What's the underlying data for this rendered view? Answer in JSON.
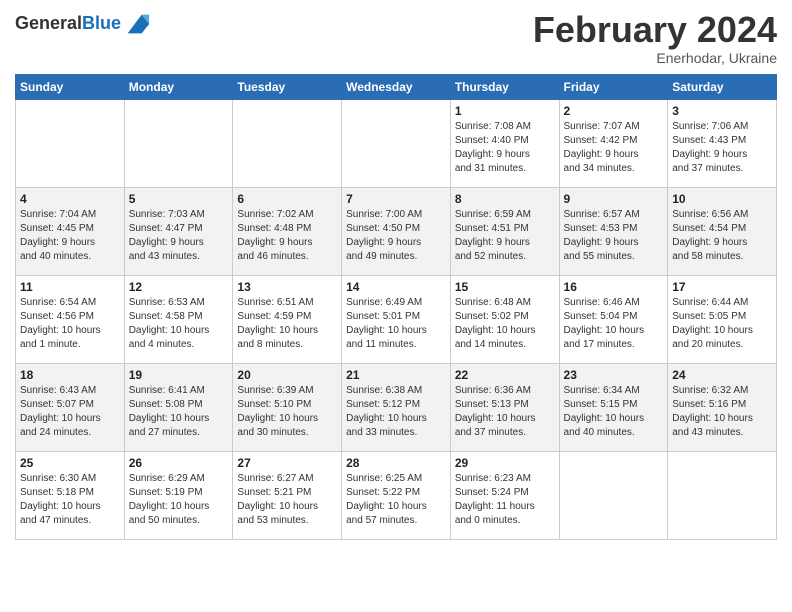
{
  "header": {
    "logo_general": "General",
    "logo_blue": "Blue",
    "month_title": "February 2024",
    "location": "Enerhodar, Ukraine"
  },
  "weekdays": [
    "Sunday",
    "Monday",
    "Tuesday",
    "Wednesday",
    "Thursday",
    "Friday",
    "Saturday"
  ],
  "weeks": [
    [
      {
        "day": "",
        "info": ""
      },
      {
        "day": "",
        "info": ""
      },
      {
        "day": "",
        "info": ""
      },
      {
        "day": "",
        "info": ""
      },
      {
        "day": "1",
        "info": "Sunrise: 7:08 AM\nSunset: 4:40 PM\nDaylight: 9 hours\nand 31 minutes."
      },
      {
        "day": "2",
        "info": "Sunrise: 7:07 AM\nSunset: 4:42 PM\nDaylight: 9 hours\nand 34 minutes."
      },
      {
        "day": "3",
        "info": "Sunrise: 7:06 AM\nSunset: 4:43 PM\nDaylight: 9 hours\nand 37 minutes."
      }
    ],
    [
      {
        "day": "4",
        "info": "Sunrise: 7:04 AM\nSunset: 4:45 PM\nDaylight: 9 hours\nand 40 minutes."
      },
      {
        "day": "5",
        "info": "Sunrise: 7:03 AM\nSunset: 4:47 PM\nDaylight: 9 hours\nand 43 minutes."
      },
      {
        "day": "6",
        "info": "Sunrise: 7:02 AM\nSunset: 4:48 PM\nDaylight: 9 hours\nand 46 minutes."
      },
      {
        "day": "7",
        "info": "Sunrise: 7:00 AM\nSunset: 4:50 PM\nDaylight: 9 hours\nand 49 minutes."
      },
      {
        "day": "8",
        "info": "Sunrise: 6:59 AM\nSunset: 4:51 PM\nDaylight: 9 hours\nand 52 minutes."
      },
      {
        "day": "9",
        "info": "Sunrise: 6:57 AM\nSunset: 4:53 PM\nDaylight: 9 hours\nand 55 minutes."
      },
      {
        "day": "10",
        "info": "Sunrise: 6:56 AM\nSunset: 4:54 PM\nDaylight: 9 hours\nand 58 minutes."
      }
    ],
    [
      {
        "day": "11",
        "info": "Sunrise: 6:54 AM\nSunset: 4:56 PM\nDaylight: 10 hours\nand 1 minute."
      },
      {
        "day": "12",
        "info": "Sunrise: 6:53 AM\nSunset: 4:58 PM\nDaylight: 10 hours\nand 4 minutes."
      },
      {
        "day": "13",
        "info": "Sunrise: 6:51 AM\nSunset: 4:59 PM\nDaylight: 10 hours\nand 8 minutes."
      },
      {
        "day": "14",
        "info": "Sunrise: 6:49 AM\nSunset: 5:01 PM\nDaylight: 10 hours\nand 11 minutes."
      },
      {
        "day": "15",
        "info": "Sunrise: 6:48 AM\nSunset: 5:02 PM\nDaylight: 10 hours\nand 14 minutes."
      },
      {
        "day": "16",
        "info": "Sunrise: 6:46 AM\nSunset: 5:04 PM\nDaylight: 10 hours\nand 17 minutes."
      },
      {
        "day": "17",
        "info": "Sunrise: 6:44 AM\nSunset: 5:05 PM\nDaylight: 10 hours\nand 20 minutes."
      }
    ],
    [
      {
        "day": "18",
        "info": "Sunrise: 6:43 AM\nSunset: 5:07 PM\nDaylight: 10 hours\nand 24 minutes."
      },
      {
        "day": "19",
        "info": "Sunrise: 6:41 AM\nSunset: 5:08 PM\nDaylight: 10 hours\nand 27 minutes."
      },
      {
        "day": "20",
        "info": "Sunrise: 6:39 AM\nSunset: 5:10 PM\nDaylight: 10 hours\nand 30 minutes."
      },
      {
        "day": "21",
        "info": "Sunrise: 6:38 AM\nSunset: 5:12 PM\nDaylight: 10 hours\nand 33 minutes."
      },
      {
        "day": "22",
        "info": "Sunrise: 6:36 AM\nSunset: 5:13 PM\nDaylight: 10 hours\nand 37 minutes."
      },
      {
        "day": "23",
        "info": "Sunrise: 6:34 AM\nSunset: 5:15 PM\nDaylight: 10 hours\nand 40 minutes."
      },
      {
        "day": "24",
        "info": "Sunrise: 6:32 AM\nSunset: 5:16 PM\nDaylight: 10 hours\nand 43 minutes."
      }
    ],
    [
      {
        "day": "25",
        "info": "Sunrise: 6:30 AM\nSunset: 5:18 PM\nDaylight: 10 hours\nand 47 minutes."
      },
      {
        "day": "26",
        "info": "Sunrise: 6:29 AM\nSunset: 5:19 PM\nDaylight: 10 hours\nand 50 minutes."
      },
      {
        "day": "27",
        "info": "Sunrise: 6:27 AM\nSunset: 5:21 PM\nDaylight: 10 hours\nand 53 minutes."
      },
      {
        "day": "28",
        "info": "Sunrise: 6:25 AM\nSunset: 5:22 PM\nDaylight: 10 hours\nand 57 minutes."
      },
      {
        "day": "29",
        "info": "Sunrise: 6:23 AM\nSunset: 5:24 PM\nDaylight: 11 hours\nand 0 minutes."
      },
      {
        "day": "",
        "info": ""
      },
      {
        "day": "",
        "info": ""
      }
    ]
  ]
}
